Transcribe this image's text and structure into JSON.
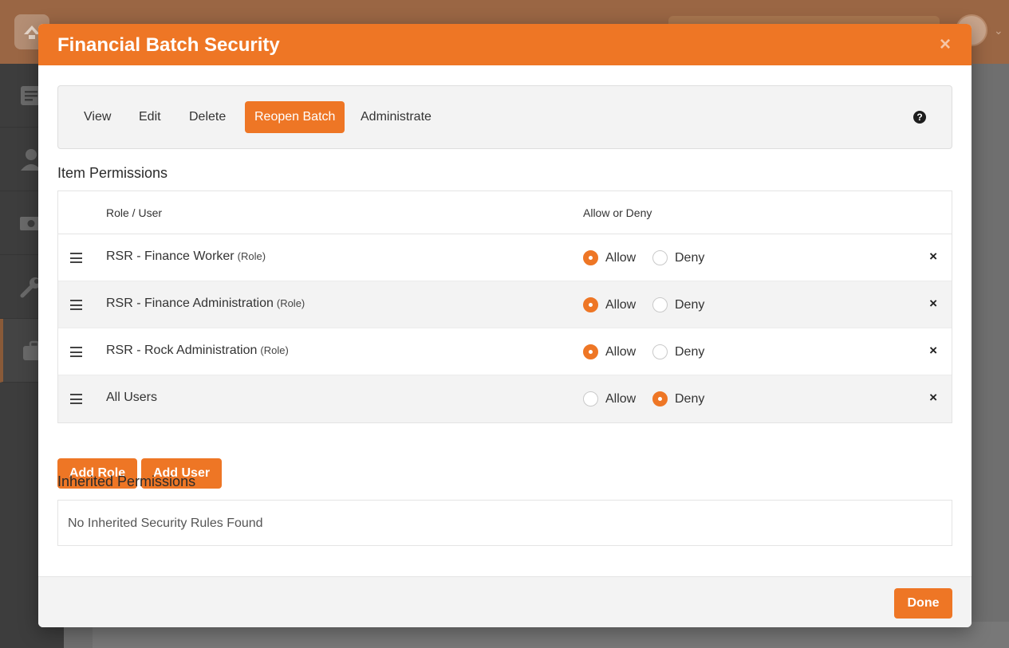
{
  "colors": {
    "accent": "#ee7625",
    "radio_off": "#c9c9c9",
    "text": "#333333"
  },
  "background_app": {
    "logo_icon": "rock-logo-icon",
    "sidebar_icons": [
      "dashboard-icon",
      "person-icon",
      "finance-icon",
      "wrench-icon",
      "briefcase-icon"
    ]
  },
  "modal": {
    "title": "Financial Batch Security",
    "close_icon": "close-icon",
    "close_glyph": "×",
    "tabs": [
      {
        "label": "View",
        "active": false
      },
      {
        "label": "Edit",
        "active": false
      },
      {
        "label": "Delete",
        "active": false
      },
      {
        "label": "Reopen Batch",
        "active": true
      },
      {
        "label": "Administrate",
        "active": false
      }
    ],
    "help_glyph": "?",
    "item_permissions": {
      "title": "Item Permissions",
      "columns": {
        "role_user": "Role / User",
        "allow_deny": "Allow or Deny"
      },
      "rows": [
        {
          "name": "RSR - Finance Worker",
          "tag": "(Role)",
          "selected": "Allow"
        },
        {
          "name": "RSR - Finance Administration",
          "tag": "(Role)",
          "selected": "Allow"
        },
        {
          "name": "RSR - Rock Administration",
          "tag": "(Role)",
          "selected": "Allow"
        },
        {
          "name": "All Users",
          "tag": "",
          "selected": "Deny"
        }
      ],
      "allow_label": "Allow",
      "deny_label": "Deny",
      "remove_glyph": "×"
    },
    "add_role_label": "Add Role",
    "add_user_label": "Add User",
    "inherited_permissions": {
      "title": "Inherited Permissions",
      "empty_text": "No Inherited Security Rules Found"
    },
    "done_label": "Done"
  }
}
